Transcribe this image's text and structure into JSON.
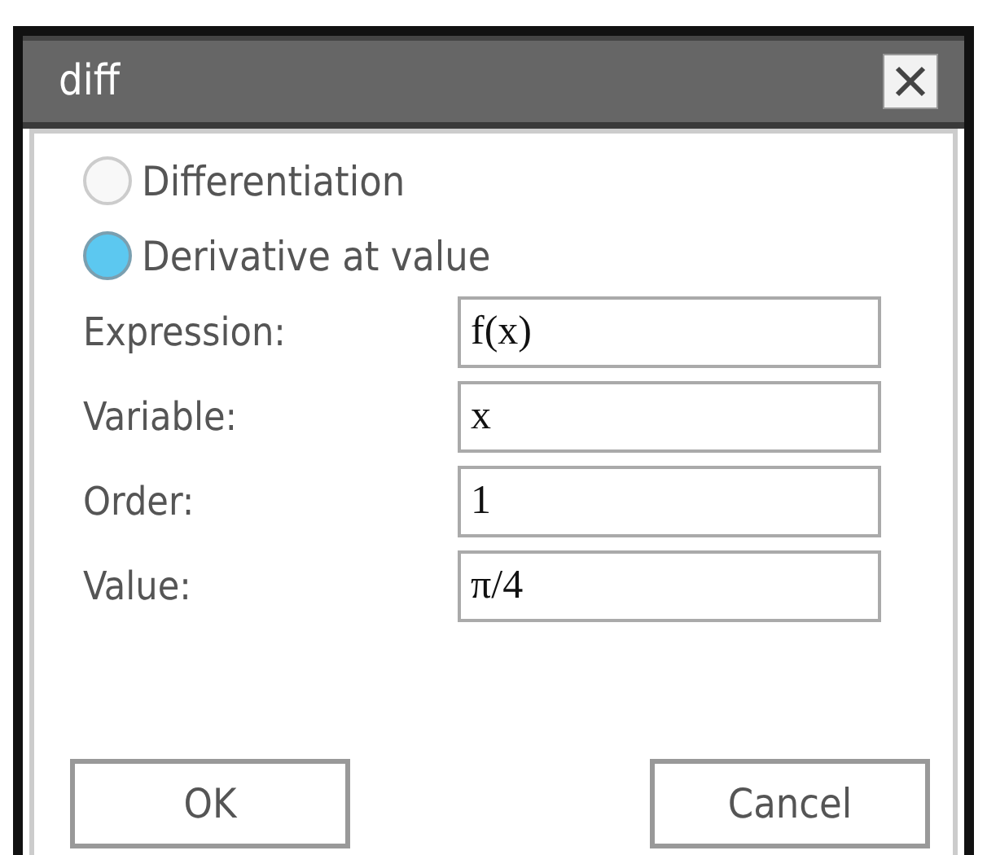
{
  "window": {
    "title": "diff"
  },
  "modes": [
    {
      "label": "Differentiation",
      "selected": false
    },
    {
      "label": "Derivative at value",
      "selected": true
    }
  ],
  "fields": [
    {
      "label": "Expression:",
      "value": "f(x)"
    },
    {
      "label": "Variable:",
      "value": "x"
    },
    {
      "label": "Order:",
      "value": "1"
    },
    {
      "label": "Value:",
      "value": "π/4"
    }
  ],
  "buttons": [
    "OK",
    "Cancel"
  ]
}
